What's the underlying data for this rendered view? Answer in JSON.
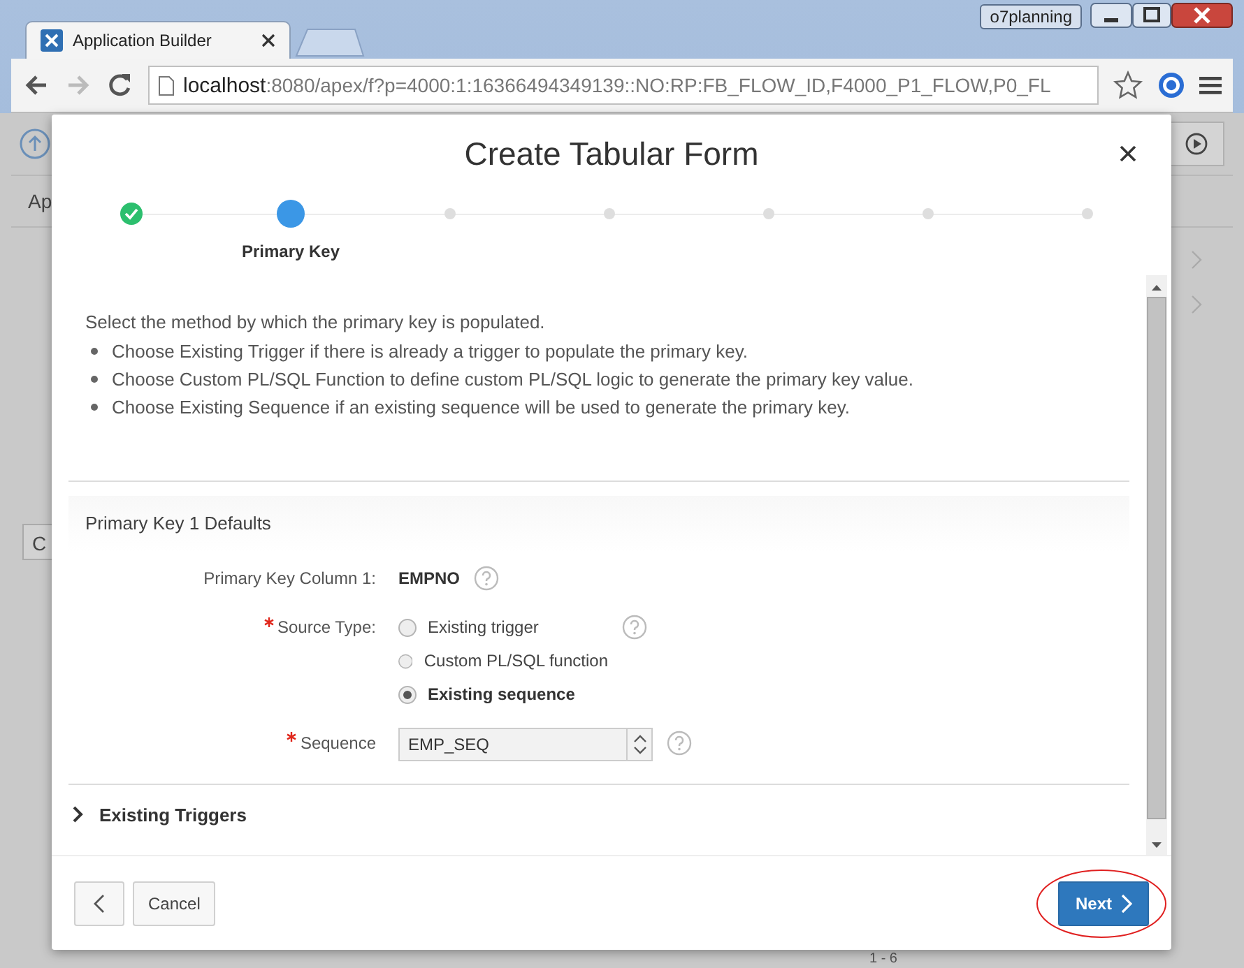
{
  "browser": {
    "profile": "o7planning",
    "tab": {
      "title": "Application Builder"
    },
    "url": {
      "host": "localhost",
      "path": ":8080/apex/f?p=4000:1:16366494349139::NO:RP:FB_FLOW_ID,F4000_P1_FLOW,P0_FL"
    },
    "forward_disabled": true
  },
  "background": {
    "row_label": "Ap",
    "button_label": "C",
    "pagination": "1 - 6"
  },
  "dialog": {
    "title": "Create Tabular Form",
    "steps": [
      {
        "kind": "complete"
      },
      {
        "kind": "current",
        "label": "Primary Key"
      },
      {
        "kind": "pending"
      },
      {
        "kind": "pending"
      },
      {
        "kind": "pending"
      },
      {
        "kind": "pending"
      },
      {
        "kind": "pending"
      }
    ],
    "intro": "Select the method by which the primary key is populated.",
    "bullets": [
      "Choose Existing Trigger if there is already a trigger to populate the primary key.",
      "Choose Custom PL/SQL Function to define custom PL/SQL logic to generate the primary key value.",
      "Choose Existing Sequence if an existing sequence will be used to generate the primary key."
    ],
    "region": {
      "title": "Primary Key 1 Defaults",
      "fields": [
        {
          "kind": "display",
          "label": "Primary Key Column 1:",
          "value": "EMPNO",
          "required": false,
          "help": true
        },
        {
          "kind": "radio",
          "label": "Source Type:",
          "required": true,
          "help": true,
          "options": [
            {
              "label": "Existing trigger",
              "selected": false
            },
            {
              "label": "Custom PL/SQL function",
              "selected": false
            },
            {
              "label": "Existing sequence",
              "selected": true
            }
          ]
        },
        {
          "kind": "select",
          "label": "Sequence",
          "value": "EMP_SEQ",
          "required": true,
          "help": true
        }
      ]
    },
    "collapsible": {
      "title": "Existing Triggers",
      "expanded": false
    },
    "buttons": [
      {
        "kind": "back"
      },
      {
        "kind": "plain",
        "label": "Cancel"
      },
      {
        "kind": "primary",
        "label": "Next",
        "annotated": true
      }
    ]
  }
}
